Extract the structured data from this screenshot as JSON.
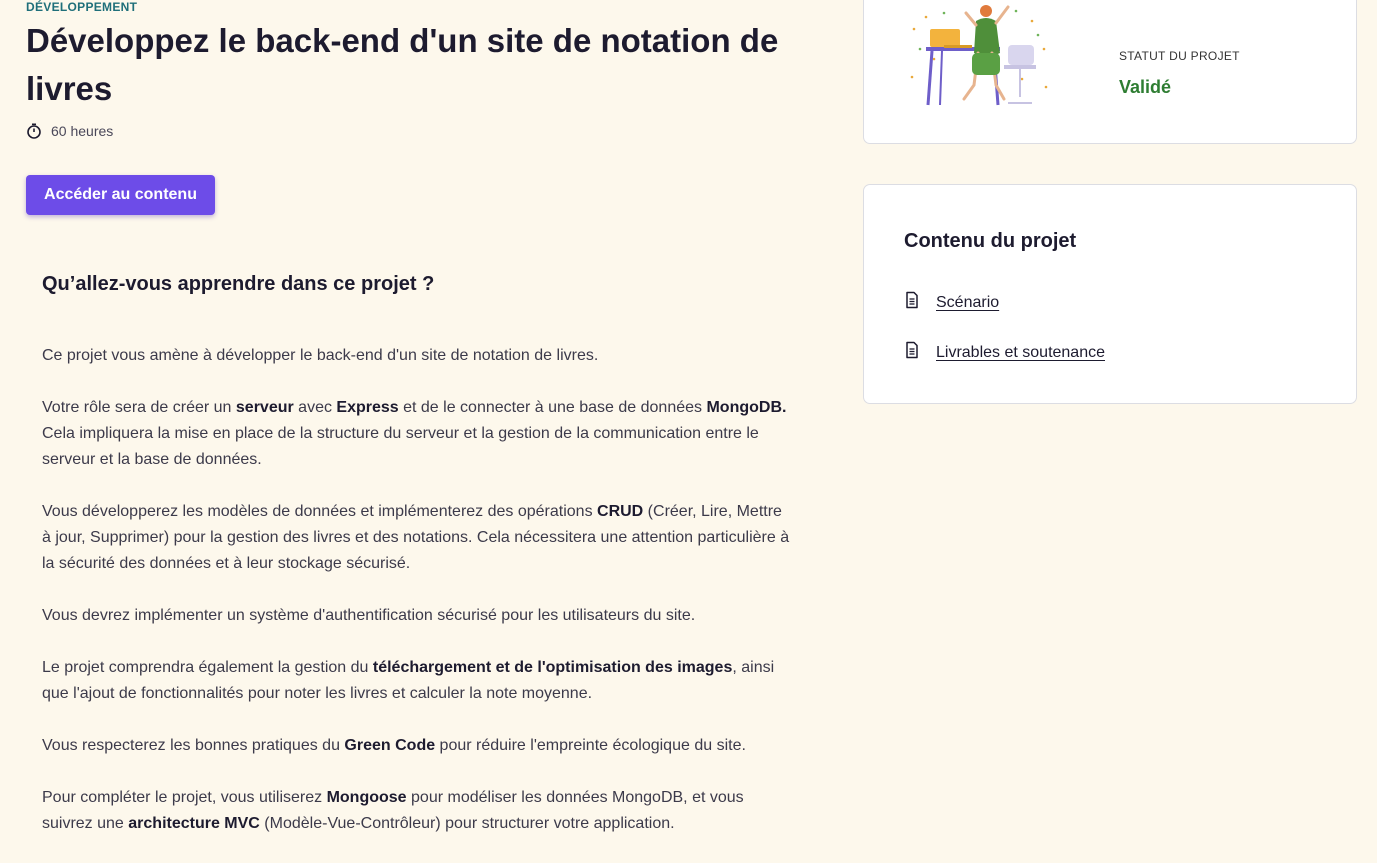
{
  "header": {
    "category": "DÉVELOPPEMENT",
    "title": "Développez le back-end d'un site de notation de livres",
    "duration": "60 heures",
    "access_button": "Accéder au contenu"
  },
  "main": {
    "heading": "Qu’allez-vous apprendre dans ce projet ?",
    "paragraphs": [
      "Ce projet vous amène à développer le back-end d'un site de notation de livres.",
      {
        "a": "Votre rôle sera de créer un ",
        "b": "serveur",
        "c": " avec ",
        "d": "Express",
        "e": " et de le connecter à une base de données ",
        "f": "MongoDB.",
        "g": " Cela impliquera la mise en place de la structure du serveur et la gestion de la communication entre le serveur et la base de données."
      },
      {
        "a": "Vous développerez les modèles de données et implémenterez des opérations ",
        "b": "CRUD",
        "c": " (Créer, Lire, Mettre à jour, Supprimer) pour la gestion des livres et des notations. Cela nécessitera une attention particulière à la sécurité des données et à leur stockage sécurisé."
      },
      "Vous devrez implémenter un système d'authentification sécurisé pour les utilisateurs du site.",
      {
        "a": "Le projet comprendra également la gestion du ",
        "b": "téléchargement et de l'optimisation des images",
        "c": ", ainsi que l'ajout de fonctionnalités pour noter les livres et calculer la note moyenne."
      },
      {
        "a": "Vous respecterez les bonnes pratiques du ",
        "b": "Green Code",
        "c": " pour réduire l'empreinte écologique du site."
      },
      {
        "a": "Pour compléter le projet, vous utiliserez ",
        "b": "Mongoose",
        "c": " pour modéliser les données MongoDB, et vous suivrez une ",
        "d": "architecture MVC",
        "e": " (Modèle-Vue-Contrôleur) pour structurer votre application."
      }
    ]
  },
  "status_card": {
    "label": "STATUT DU PROJET",
    "value": "Validé",
    "value_color": "#2e7d32"
  },
  "content_card": {
    "title": "Contenu du projet",
    "links": [
      {
        "label": "Scénario",
        "icon": "document-icon"
      },
      {
        "label": "Livrables et soutenance",
        "icon": "document-icon"
      }
    ]
  },
  "colors": {
    "background": "#fdf8ec",
    "accent": "#6d4ce8",
    "category": "#1f6f7a"
  }
}
